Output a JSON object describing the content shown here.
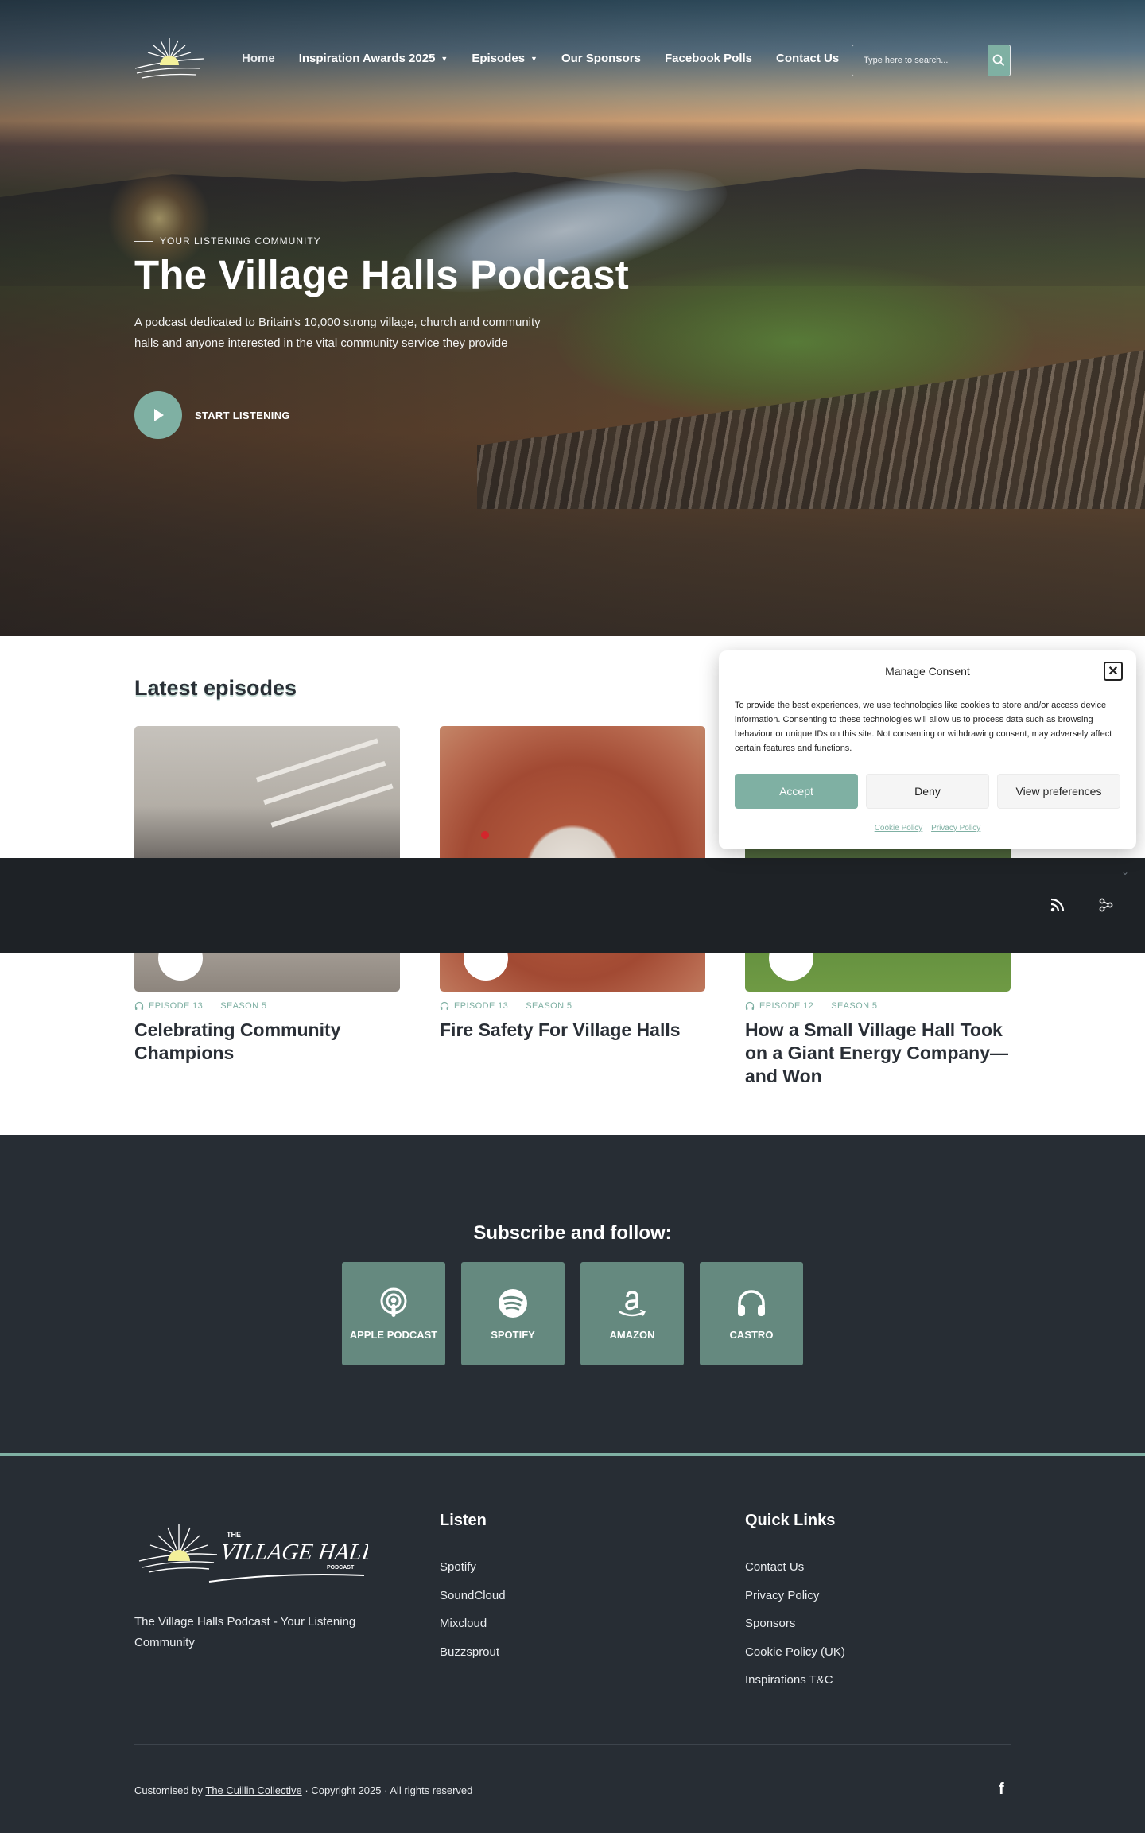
{
  "header": {
    "nav": [
      {
        "label": "Home"
      },
      {
        "label": "Inspiration Awards 2025",
        "dropdown": true
      },
      {
        "label": "Episodes",
        "dropdown": true
      },
      {
        "label": "Our Sponsors"
      },
      {
        "label": "Facebook Polls"
      },
      {
        "label": "Contact Us"
      }
    ],
    "search_placeholder": "Type here to search..."
  },
  "hero": {
    "eyebrow": "YOUR LISTENING COMMUNITY",
    "title": "The Village Halls Podcast",
    "description": "A podcast dedicated to Britain's 10,000 strong village, church and community halls and anyone interested in the vital community service they provide",
    "cta": "START LISTENING"
  },
  "latest": {
    "title": "Latest episodes",
    "episodes": [
      {
        "episode": "EPISODE 13",
        "season": "SEASON 5",
        "title": "Celebrating Community Champions"
      },
      {
        "episode": "EPISODE 13",
        "season": "SEASON 5",
        "title": "Fire Safety For Village Halls"
      },
      {
        "episode": "EPISODE 12",
        "season": "SEASON 5",
        "title": "How a Small Village Hall Took on a Giant Energy Company—and Won"
      }
    ]
  },
  "consent": {
    "title": "Manage Consent",
    "text": "To provide the best experiences, we use technologies like cookies to store and/or access device information. Consenting to these technologies will allow us to process data such as browsing behaviour or unique IDs on this site. Not consenting or withdrawing consent, may adversely affect certain features and functions.",
    "accept": "Accept",
    "deny": "Deny",
    "preferences": "View preferences",
    "cookie_policy": "Cookie Policy",
    "privacy_policy": "Privacy Policy"
  },
  "subscribe": {
    "title": "Subscribe and follow:",
    "platforms": [
      {
        "label": "APPLE PODCAST",
        "icon": "apple-podcast-icon"
      },
      {
        "label": "SPOTIFY",
        "icon": "spotify-icon"
      },
      {
        "label": "AMAZON",
        "icon": "amazon-icon"
      },
      {
        "label": "CASTRO",
        "icon": "headphones-icon"
      }
    ]
  },
  "footer": {
    "logo": {
      "the": "THE",
      "name": "VILLAGE HALLS",
      "sub": "PODCAST"
    },
    "tagline": "The Village Halls Podcast - Your Listening Community",
    "listen": {
      "title": "Listen",
      "links": [
        "Spotify",
        "SoundCloud",
        "Mixcloud",
        "Buzzsprout"
      ]
    },
    "quick_links": {
      "title": "Quick Links",
      "links": [
        "Contact Us",
        "Privacy Policy",
        "Sponsors",
        "Cookie Policy (UK)",
        "Inspirations T&C"
      ]
    },
    "copyright_prefix": "Customised by",
    "copyright_credit": "The Cuillin Collective",
    "copyright_suffix": "· Copyright 2025 · All rights reserved"
  },
  "colors": {
    "accent": "#7fb0a3",
    "dark": "#272d34",
    "tile": "#65897f",
    "player": "#1e2226"
  }
}
